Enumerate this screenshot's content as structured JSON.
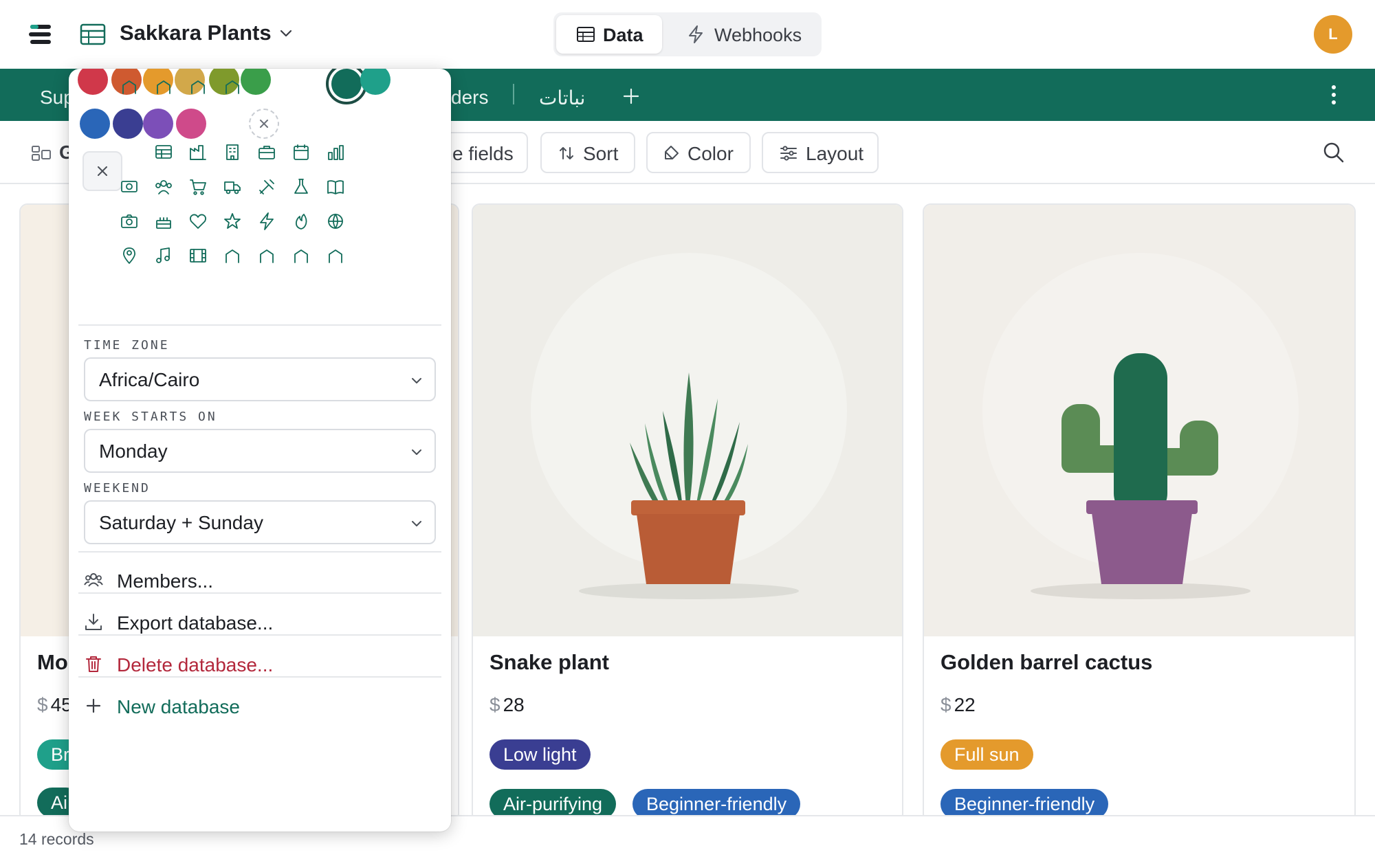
{
  "header": {
    "db_title": "Sakkara Plants",
    "tabs": {
      "data": "Data",
      "webhooks": "Webhooks"
    },
    "avatar_letter": "L"
  },
  "tabbar": {
    "tabs": [
      "Sup",
      "ders",
      "نباتات"
    ]
  },
  "toolbar": {
    "view_label": "G",
    "fields_label": "e fields",
    "sort_label": "Sort",
    "color_label": "Color",
    "layout_label": "Layout"
  },
  "popup": {
    "colors": [
      "#d0384a",
      "#cf5a30",
      "#e49a2c",
      "#d2a84a",
      "#7f9a2c",
      "#3a9e4a",
      "#126c5a",
      "#1fa08a",
      "#2a66b8",
      "#3a3e92",
      "#7c4fb8",
      "#cf4a8a"
    ],
    "selected_color": "#126c5a",
    "icons": [
      "table",
      "factory",
      "building",
      "briefcase",
      "calendar",
      "bar-chart",
      "money",
      "people",
      "cart",
      "truck",
      "tools",
      "flask",
      "book",
      "camera",
      "cake",
      "heart",
      "star",
      "bolt",
      "fire",
      "globe",
      "pin",
      "music",
      "film",
      "misc-1",
      "misc-2",
      "misc-3",
      "misc-4",
      "misc-5",
      "misc-6",
      "misc-7",
      "misc-8"
    ],
    "time_zone": {
      "label": "TIME ZONE",
      "value": "Africa/Cairo"
    },
    "week_starts_on": {
      "label": "WEEK STARTS ON",
      "value": "Monday"
    },
    "weekend": {
      "label": "WEEKEND",
      "value": "Saturday + Sunday"
    },
    "menu": {
      "members": "Members...",
      "export": "Export database...",
      "delete": "Delete database...",
      "new": "New database"
    }
  },
  "cards": [
    {
      "title": "Mo",
      "currency": "$",
      "price": "45",
      "tags": [
        "Br",
        "Ai"
      ]
    },
    {
      "title": "Snake plant",
      "currency": "$",
      "price": "28",
      "tags": [
        "Low light",
        "Air-purifying",
        "Beginner-friendly"
      ]
    },
    {
      "title": "Golden barrel cactus",
      "currency": "$",
      "price": "22",
      "tags": [
        "Full sun",
        "Beginner-friendly"
      ]
    }
  ],
  "footer": {
    "records": "14 records"
  },
  "theme": {
    "accent": "#126c5a",
    "danger": "#b3283c"
  }
}
